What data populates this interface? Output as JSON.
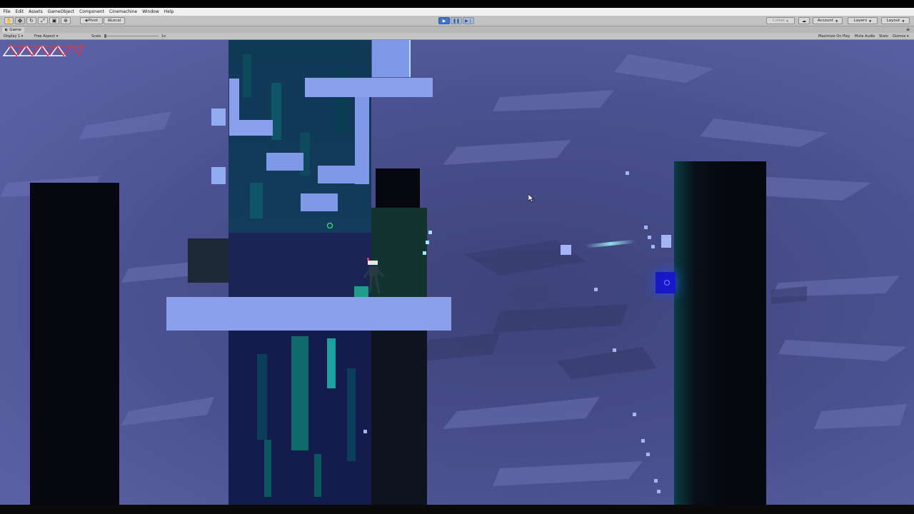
{
  "menu": [
    "File",
    "Edit",
    "Assets",
    "GameObject",
    "Component",
    "Cinemachine",
    "Window",
    "Help"
  ],
  "toolbar": {
    "pivot_label": "Pivot",
    "local_label": "Local",
    "collab_label": "Collab",
    "account_label": "Account",
    "layers_label": "Layers",
    "layout_label": "Layout",
    "play_icon": "play-icon",
    "pause_icon": "pause-icon",
    "step_icon": "step-icon"
  },
  "game_tab": {
    "label": "Game"
  },
  "game_options": {
    "display": "Display 1",
    "aspect": "Free Aspect",
    "scale_label": "Scale",
    "scale_value": "1x",
    "maximize_on_play": "Maximize On Play",
    "mute_audio": "Mute Audio",
    "stats": "Stats",
    "gizmos": "Gizmos"
  },
  "colors": {
    "background": "#4a4f8c",
    "platform": "#7f98e8",
    "pillar": "#07070f",
    "accent_teal": "#1fa0a0",
    "accent_red": "#e0344a"
  },
  "hud": {
    "icon": "health-triangles-icon"
  }
}
